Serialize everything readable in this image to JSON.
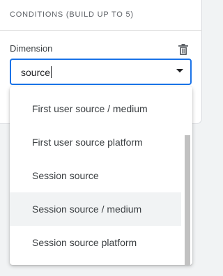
{
  "conditions": {
    "title": "CONDITIONS (BUILD UP TO 5)",
    "dimension_label": "Dimension",
    "dimension_value": "source",
    "delete_icon": "trash-icon",
    "dropdown_arrow_icon": "arrow-drop-down-icon",
    "accent_color": "#1a73e8"
  },
  "dropdown": {
    "options": [
      {
        "label": "First user source / medium"
      },
      {
        "label": "First user source platform"
      },
      {
        "label": "Session source"
      },
      {
        "label": "Session source / medium",
        "highlighted": true
      },
      {
        "label": "Session source platform"
      }
    ]
  }
}
